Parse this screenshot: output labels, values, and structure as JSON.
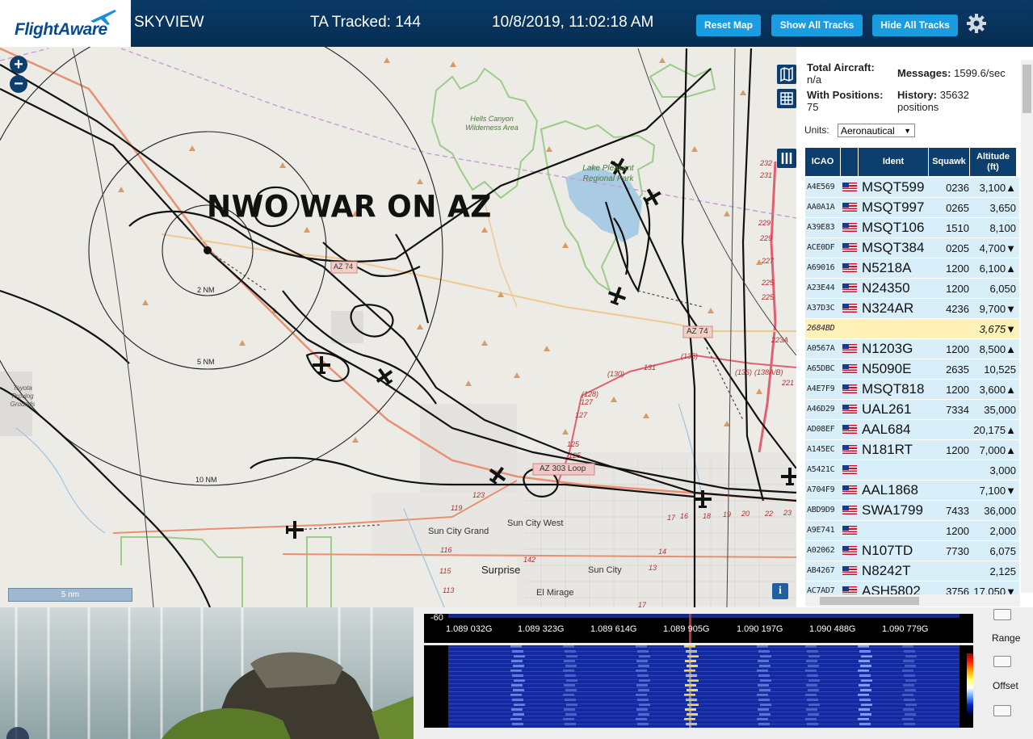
{
  "header": {
    "logo_text": "FlightAware",
    "app_name": "SKYVIEW",
    "tracked": "TA Tracked: 144",
    "datetime": "10/8/2019, 11:02:18 AM",
    "buttons": {
      "reset": "Reset Map",
      "show": "Show All Tracks",
      "hide": "Hide All Tracks"
    },
    "gear_icon": "gear-icon"
  },
  "map": {
    "zoom_in": "+",
    "zoom_out": "−",
    "overlay_text": "NWO WAR ON AZ",
    "scale_text": "5 nm",
    "info_label": "i",
    "ring_labels": [
      "2 NM",
      "5 NM",
      "10 NM"
    ],
    "places": {
      "hells_canyon": "Hells Canyon Wilderness Area",
      "lake_pleasant": "Lake Pleasant Regional Park",
      "toyota": "Toyota Proving Grounds",
      "sun_city_grand": "Sun City Grand",
      "sun_city_west": "Sun City West",
      "surprise": "Surprise",
      "sun_city": "Sun City",
      "el_mirage": "El Mirage",
      "az74": "AZ 74",
      "az303": "AZ 303 Loop",
      "az74_small": "AZ 74"
    },
    "route_numbers": [
      "232",
      "231",
      "229",
      "229",
      "227",
      "225",
      "225",
      "223A",
      "221",
      "(135)",
      "(136)",
      "(138A/B)",
      "131",
      "(130)",
      "(128)",
      "127",
      "127",
      "125",
      "125",
      "123",
      "119",
      "116",
      "115",
      "113",
      "142",
      "17",
      "16",
      "18",
      "19",
      "20",
      "22",
      "23",
      "14",
      "13",
      "17"
    ]
  },
  "sidebar": {
    "total_label": "Total Aircraft:",
    "total_value": "n/a",
    "positions_label": "With Positions:",
    "positions_value": "75",
    "messages_label": "Messages:",
    "messages_value": "1599.6/sec",
    "history_label": "History:",
    "history_value": "35632",
    "history_unit": "positions",
    "units_label": "Units:",
    "units_value": "Aeronautical",
    "map_icon": "map-icon",
    "grid_icon": "grid-icon",
    "columns_icon": "columns-icon",
    "columns": {
      "icao": "ICAO",
      "ident": "Ident",
      "squawk": "Squawk",
      "altitude": "Altitude (ft)"
    },
    "rows": [
      {
        "icao": "A4E569",
        "ident": "MSQT599",
        "squawk": "0236",
        "alt": "3,100",
        "trend": "▲",
        "flag": true
      },
      {
        "icao": "AA0A1A",
        "ident": "MSQT997",
        "squawk": "0265",
        "alt": "3,650",
        "trend": "",
        "flag": true
      },
      {
        "icao": "A39E83",
        "ident": "MSQT106",
        "squawk": "1510",
        "alt": "8,100",
        "trend": "",
        "flag": true
      },
      {
        "icao": "ACE0DF",
        "ident": "MSQT384",
        "squawk": "0205",
        "alt": "4,700",
        "trend": "▼",
        "flag": true
      },
      {
        "icao": "A69016",
        "ident": "N5218A",
        "squawk": "1200",
        "alt": "6,100",
        "trend": "▲",
        "flag": true
      },
      {
        "icao": "A23E44",
        "ident": "N24350",
        "squawk": "1200",
        "alt": "6,050",
        "trend": "",
        "flag": true
      },
      {
        "icao": "A37D3C",
        "ident": "N324AR",
        "squawk": "4236",
        "alt": "9,700",
        "trend": "▼",
        "flag": true
      },
      {
        "icao": "2684BD",
        "ident": "",
        "squawk": "",
        "alt": "3,675",
        "trend": "▼",
        "flag": false,
        "hl": true
      },
      {
        "icao": "A0567A",
        "ident": "N1203G",
        "squawk": "1200",
        "alt": "8,500",
        "trend": "▲",
        "flag": true
      },
      {
        "icao": "A65DBC",
        "ident": "N5090E",
        "squawk": "2635",
        "alt": "10,525",
        "trend": "",
        "flag": true
      },
      {
        "icao": "A4E7F9",
        "ident": "MSQT818",
        "squawk": "1200",
        "alt": "3,600",
        "trend": "▲",
        "flag": true
      },
      {
        "icao": "A46D29",
        "ident": "UAL261",
        "squawk": "7334",
        "alt": "35,000",
        "trend": "",
        "flag": true
      },
      {
        "icao": "AD08EF",
        "ident": "AAL684",
        "squawk": "",
        "alt": "20,175",
        "trend": "▲",
        "flag": true
      },
      {
        "icao": "A145EC",
        "ident": "N181RT",
        "squawk": "1200",
        "alt": "7,000",
        "trend": "▲",
        "flag": true
      },
      {
        "icao": "A5421C",
        "ident": "",
        "squawk": "",
        "alt": "3,000",
        "trend": "",
        "flag": true
      },
      {
        "icao": "A704F9",
        "ident": "AAL1868",
        "squawk": "",
        "alt": "7,100",
        "trend": "▼",
        "flag": true
      },
      {
        "icao": "ABD9D9",
        "ident": "SWA1799",
        "squawk": "7433",
        "alt": "36,000",
        "trend": "",
        "flag": true
      },
      {
        "icao": "A9E741",
        "ident": "",
        "squawk": "1200",
        "alt": "2,000",
        "trend": "",
        "flag": true
      },
      {
        "icao": "A02062",
        "ident": "N107TD",
        "squawk": "7730",
        "alt": "6,075",
        "trend": "",
        "flag": true
      },
      {
        "icao": "AB4267",
        "ident": "N8242T",
        "squawk": "",
        "alt": "2,125",
        "trend": "",
        "flag": true
      },
      {
        "icao": "AC7AD7",
        "ident": "ASH5802",
        "squawk": "3756",
        "alt": "17,050",
        "trend": "▼",
        "flag": true
      }
    ]
  },
  "sdr": {
    "db_label": "-60",
    "freqs": [
      "1.089 032G",
      "1.089 323G",
      "1.089 614G",
      "1.089 905G",
      "1.090 197G",
      "1.090 488G",
      "1.090 779G"
    ],
    "range_label": "Range",
    "offset_label": "Offset"
  }
}
